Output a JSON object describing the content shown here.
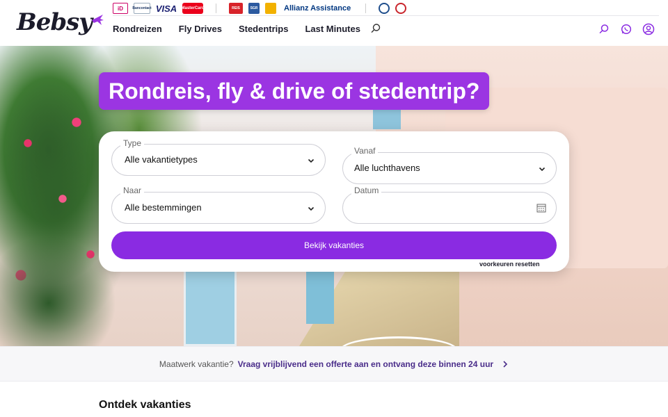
{
  "brand": {
    "logo_text": "Bebsy",
    "accent": "#8a2be2"
  },
  "trust_bar": {
    "badges": [
      "iD",
      "Bancontact",
      "VISA",
      "MasterCard",
      "REIS",
      "SGR",
      "",
      "Allianz Assistance",
      "",
      "SGR"
    ]
  },
  "nav": {
    "items": [
      "Rondreizen",
      "Fly Drives",
      "Stedentrips",
      "Last Minutes"
    ]
  },
  "header_icons": [
    "search-icon",
    "whatsapp-icon",
    "user-icon"
  ],
  "hero": {
    "title": "Rondreis, fly & drive of stedentrip?"
  },
  "search": {
    "type": {
      "label": "Type",
      "value": "Alle vakantietypes"
    },
    "from": {
      "label": "Vanaf",
      "value": "Alle luchthavens"
    },
    "to": {
      "label": "Naar",
      "value": "Alle bestemmingen"
    },
    "date": {
      "label": "Datum",
      "value": ""
    },
    "submit_label": "Bekijk vakanties",
    "reset_label": "voorkeuren resetten"
  },
  "offer_strip": {
    "question": "Maatwerk vakantie?",
    "link": "Vraag vrijblijvend een offerte aan en ontvang deze binnen 24 uur"
  },
  "section": {
    "title": "Ontdek vakanties"
  }
}
